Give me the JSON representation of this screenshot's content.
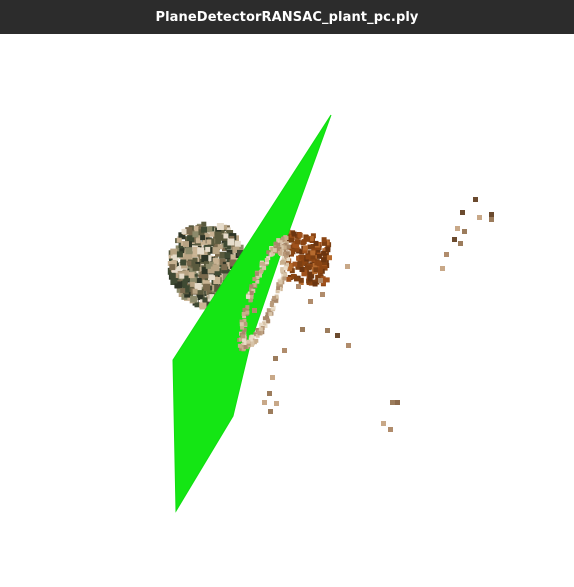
{
  "window": {
    "title": "PlaneDetectorRANSAC_plant_pc.ply"
  },
  "scene": {
    "background_color": "#ffffff",
    "plane_color": "#14e614",
    "plane_edge_color": "#12dd12",
    "leaf_colors": [
      "#3f4a33",
      "#7a6a4e",
      "#c9b393",
      "#2e3526",
      "#e6dccb",
      "#8c8a6b",
      "#5a5a3e",
      "#b8a484"
    ],
    "stem_colors": [
      "#8b4513",
      "#a0521c",
      "#6b3510",
      "#b56a2e",
      "#7c3f12"
    ],
    "pot_colors": [
      "#d8c4a8",
      "#c9ae8c",
      "#b89a7a",
      "#e9dcc8",
      "#a8886a"
    ],
    "scatter_colors": [
      "#b08c6c",
      "#8c6a4c",
      "#c8a888",
      "#6b4a2e",
      "#9c7c5c"
    ]
  }
}
